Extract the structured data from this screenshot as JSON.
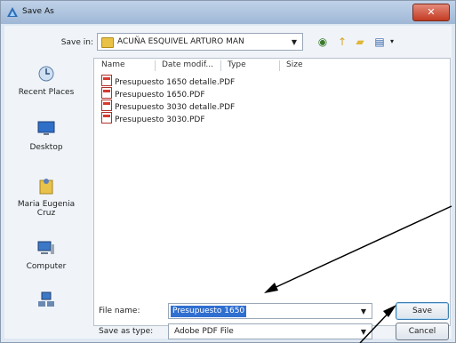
{
  "window": {
    "title": "Save As",
    "close_glyph": "✕"
  },
  "save_in": {
    "label": "Save in:",
    "value": "ACUÑA ESQUIVEL ARTURO MAN"
  },
  "toolbar": {
    "icons": [
      "back-icon",
      "up-folder-icon",
      "new-folder-icon",
      "views-menu-icon"
    ]
  },
  "places": [
    {
      "label": "Recent Places",
      "icon": "recent-places-icon"
    },
    {
      "label": "Desktop",
      "icon": "desktop-icon"
    },
    {
      "label": "Maria Eugenia Cruz",
      "icon": "user-folder-icon"
    },
    {
      "label": "Computer",
      "icon": "computer-icon"
    },
    {
      "label": "",
      "icon": "network-icon"
    }
  ],
  "columns": [
    "Name",
    "Date modif...",
    "Type",
    "Size"
  ],
  "files": [
    "Presupuesto 1650 detalle.PDF",
    "Presupuesto 1650.PDF",
    "Presupuesto 3030 detalle.PDF",
    "Presupuesto 3030.PDF"
  ],
  "file_name": {
    "label": "File name:",
    "value": "Presupuesto 1650"
  },
  "save_as_type": {
    "label": "Save as type:",
    "value": "Adobe PDF File"
  },
  "buttons": {
    "save": "Save",
    "cancel": "Cancel"
  },
  "colors": {
    "title_gradient_top": "#bfd2e8",
    "selection": "#2f6fd0",
    "close": "#c23b22"
  }
}
